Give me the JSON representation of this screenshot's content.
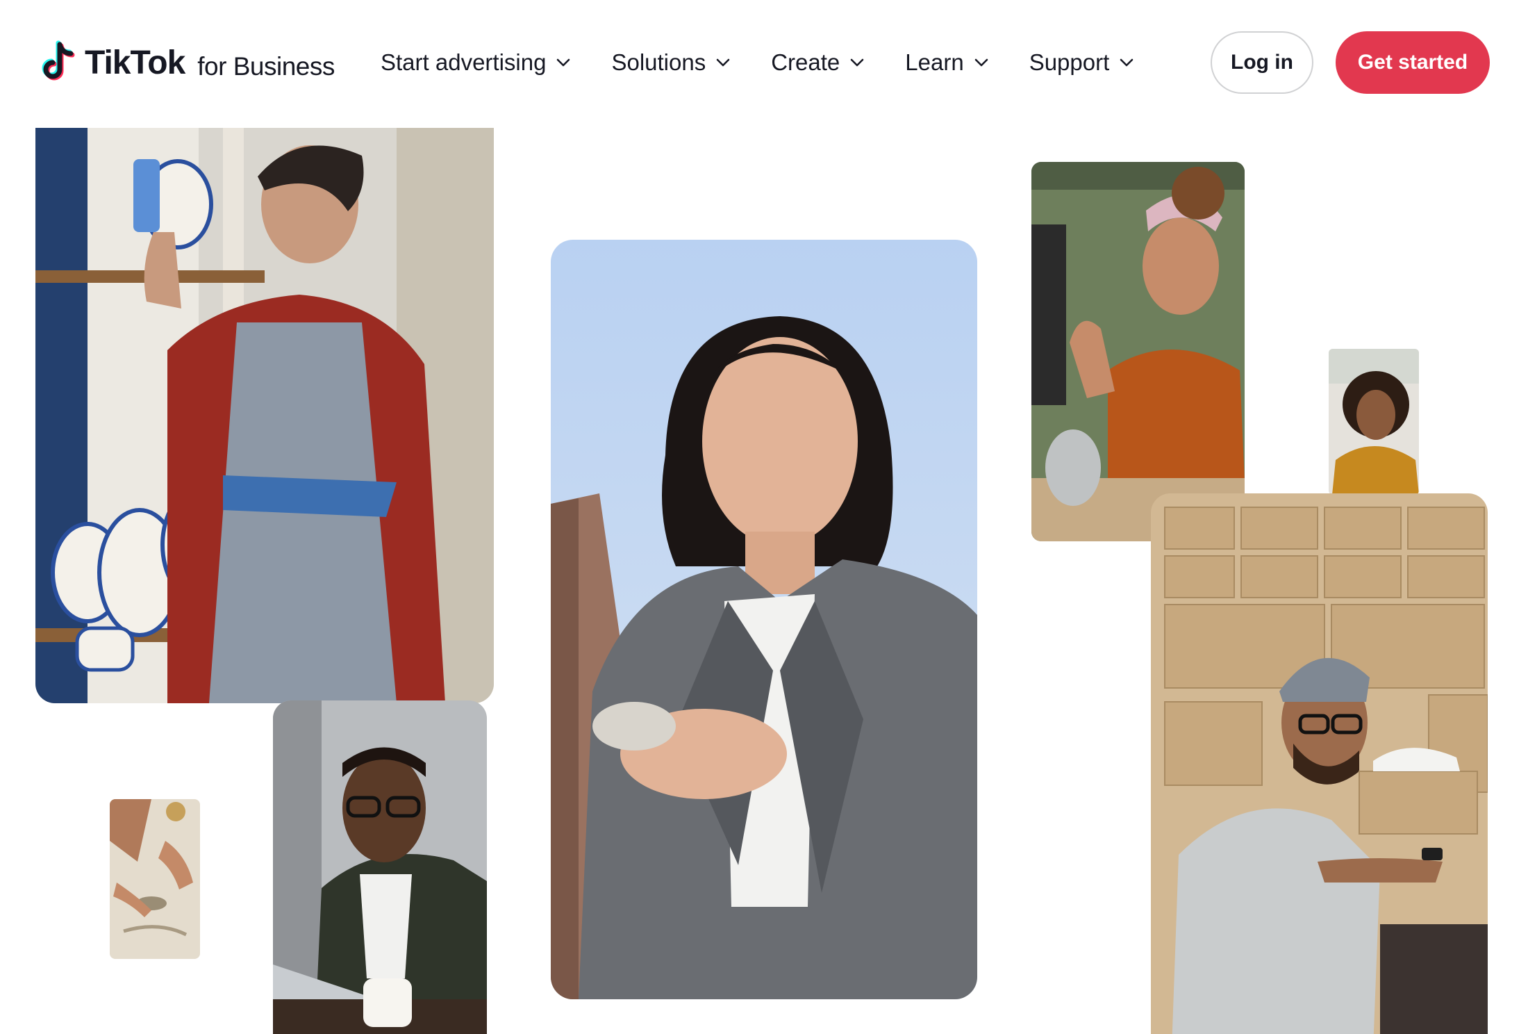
{
  "brand": {
    "wordmark": "TikTok",
    "suffix": "for Business",
    "colors": {
      "cyan": "#25f4ee",
      "red": "#fe2c55",
      "ink": "#161823"
    }
  },
  "nav": {
    "items": [
      {
        "label": "Start advertising",
        "icon": "chevron-down-icon"
      },
      {
        "label": "Solutions",
        "icon": "chevron-down-icon"
      },
      {
        "label": "Create",
        "icon": "chevron-down-icon"
      },
      {
        "label": "Learn",
        "icon": "chevron-down-icon"
      },
      {
        "label": "Support",
        "icon": "chevron-down-icon"
      }
    ]
  },
  "actions": {
    "login_label": "Log in",
    "get_started_label": "Get started",
    "accent_color": "#e2384f"
  },
  "collage": {
    "photos": [
      {
        "name": "ceramic-artist-photo"
      },
      {
        "name": "man-on-laptop-photo"
      },
      {
        "name": "clay-crafting-photo"
      },
      {
        "name": "woman-with-phone-photo"
      },
      {
        "name": "woman-waving-photo"
      },
      {
        "name": "woman-curly-hair-photo"
      },
      {
        "name": "man-with-boxes-photo"
      }
    ]
  }
}
